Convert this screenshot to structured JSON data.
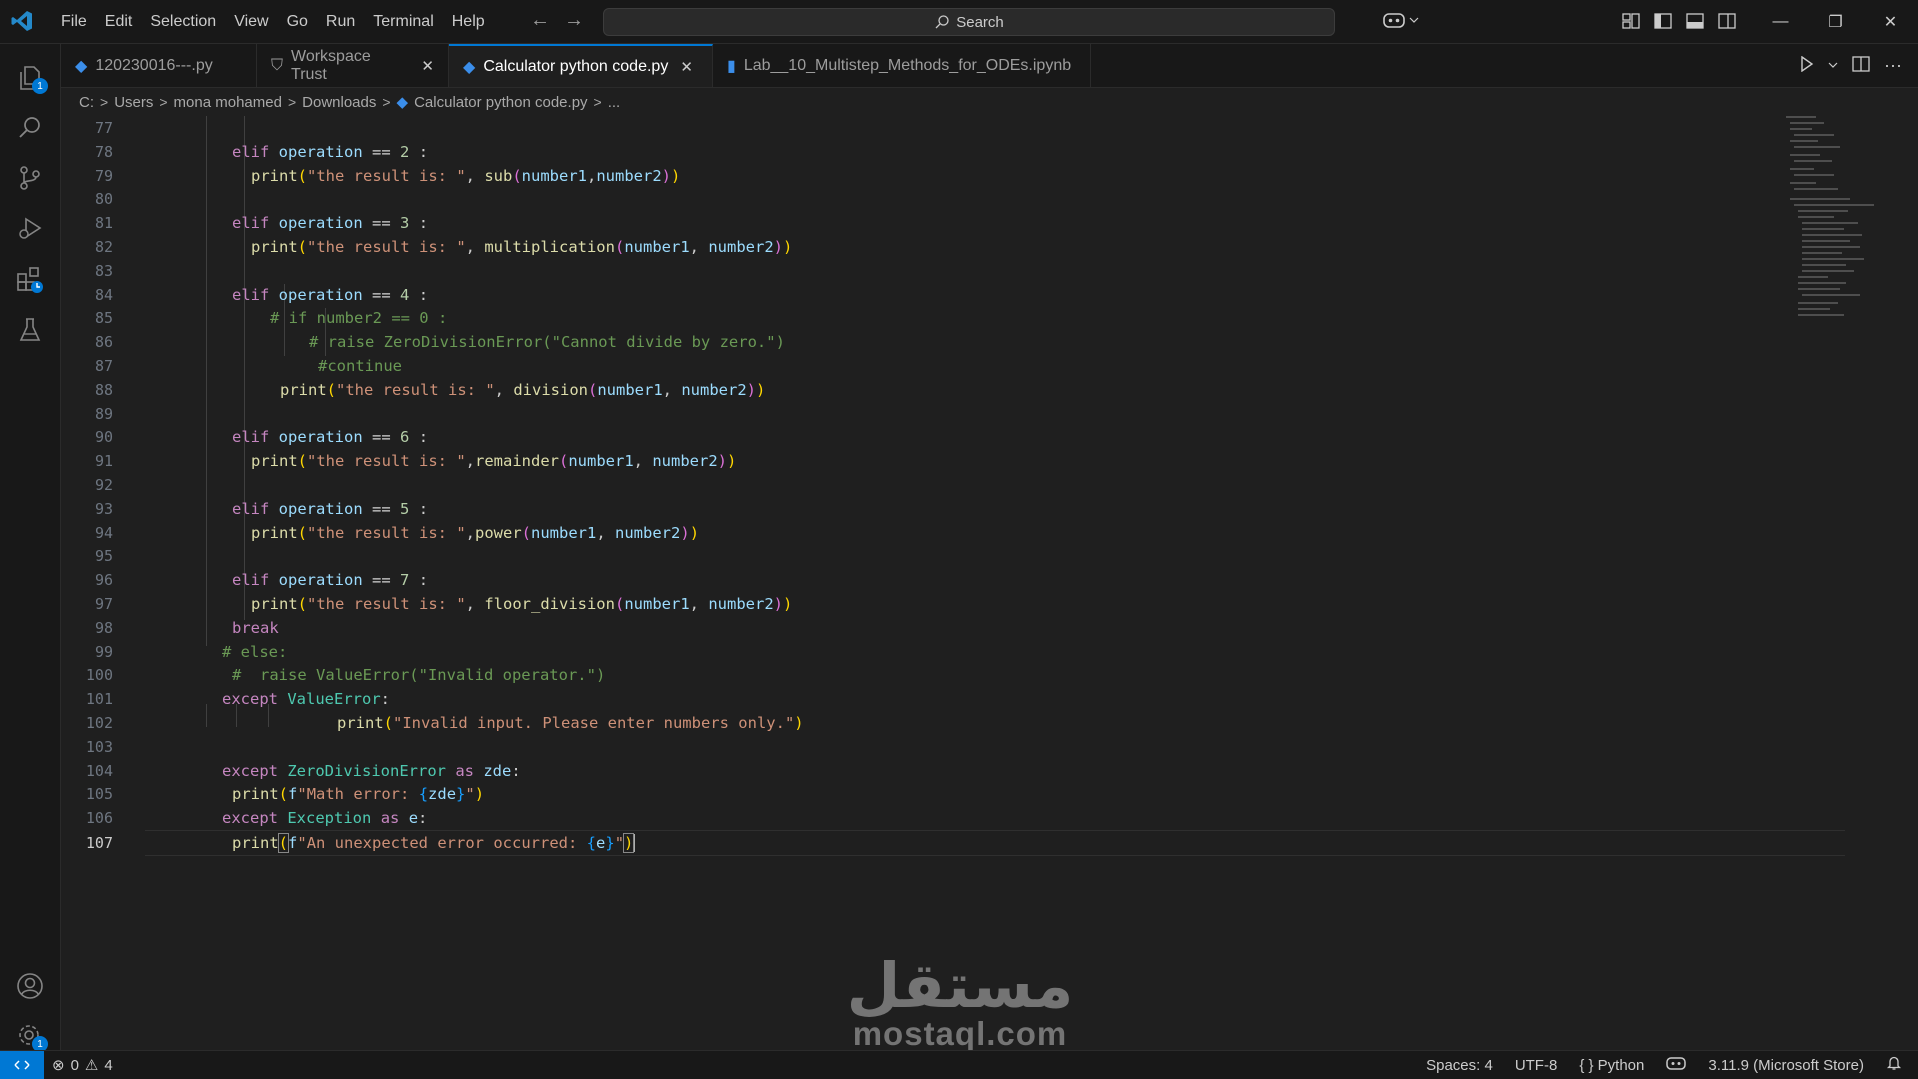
{
  "menu": [
    "File",
    "Edit",
    "Selection",
    "View",
    "Go",
    "Run",
    "Terminal",
    "Help"
  ],
  "search": {
    "label": "Search"
  },
  "tabs": [
    {
      "label": "120230016---.py",
      "state": "inactive"
    },
    {
      "label": "Workspace Trust",
      "state": "inactive"
    },
    {
      "label": "Calculator python code.py",
      "state": "active"
    },
    {
      "label": "Lab__10_Multistep_Methods_for_ODEs.ipynb",
      "state": "modified"
    }
  ],
  "breadcrumb": [
    "C:",
    "Users",
    "mona mohamed",
    "Downloads",
    "Calculator python code.py",
    "..."
  ],
  "activity_badges": {
    "explorer": "1",
    "settings": "1"
  },
  "editor": {
    "line_numbers": [
      "77",
      "78",
      "79",
      "80",
      "81",
      "82",
      "83",
      "84",
      "85",
      "86",
      "87",
      "88",
      "89",
      "90",
      "91",
      "92",
      "93",
      "94",
      "95",
      "96",
      "97",
      "98",
      "99",
      "100",
      "101",
      "102",
      "103",
      "104",
      "105",
      "106",
      "107"
    ],
    "current_line": "107"
  },
  "watermark": {
    "arabic": "مستقل",
    "latin": "mostaql.com"
  },
  "status": {
    "errors": "0",
    "warnings": "4",
    "spaces": "Spaces: 4",
    "encoding": "UTF-8",
    "language": "Python",
    "interpreter": "3.11.9 (Microsoft Store)"
  }
}
